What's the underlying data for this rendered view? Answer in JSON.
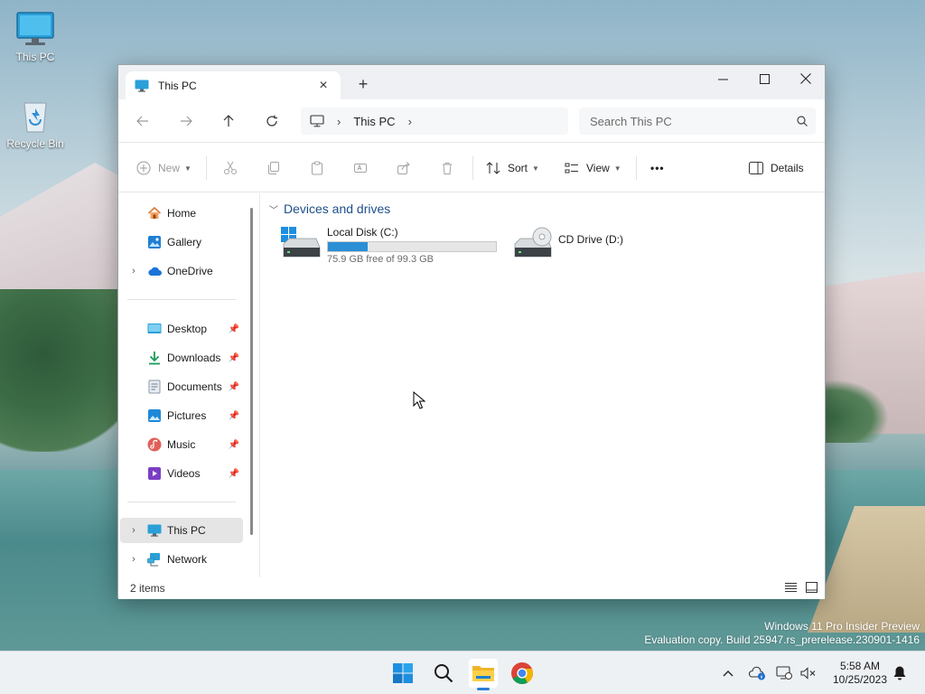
{
  "desktop": {
    "icons": [
      {
        "label": "This PC"
      },
      {
        "label": "Recycle Bin"
      }
    ],
    "watermark": {
      "line1": "Windows 11 Pro Insider Preview",
      "line2": "Evaluation copy. Build 25947.rs_prerelease.230901-1416"
    }
  },
  "window": {
    "tab": {
      "title": "This PC",
      "icon": "monitor-icon"
    },
    "new_tab_label": "+",
    "controls": {
      "minimize": "—",
      "maximize": "☐",
      "close": "✕"
    },
    "address": {
      "crumb_root_icon": "monitor-icon",
      "crumbs": [
        "This PC"
      ]
    },
    "search": {
      "placeholder": "Search This PC",
      "value": ""
    },
    "toolbar": {
      "new_label": "New",
      "sort_label": "Sort",
      "view_label": "View",
      "more_label": "•••",
      "details_label": "Details"
    },
    "nav": {
      "items": [
        {
          "label": "Home",
          "icon": "home-icon"
        },
        {
          "label": "Gallery",
          "icon": "gallery-icon"
        },
        {
          "label": "OneDrive",
          "icon": "cloud-icon"
        },
        {
          "label": "Desktop",
          "icon": "desktop-folder-icon"
        },
        {
          "label": "Downloads",
          "icon": "download-icon"
        },
        {
          "label": "Documents",
          "icon": "document-icon"
        },
        {
          "label": "Pictures",
          "icon": "pictures-icon"
        },
        {
          "label": "Music",
          "icon": "music-icon"
        },
        {
          "label": "Videos",
          "icon": "video-icon"
        },
        {
          "label": "This PC",
          "icon": "monitor-icon"
        },
        {
          "label": "Network",
          "icon": "network-icon"
        }
      ],
      "selected": "This PC"
    },
    "content": {
      "group_title": "Devices and drives",
      "drives": [
        {
          "name": "Local Disk (C:)",
          "free_text": "75.9 GB free of 99.3 GB",
          "used_fraction": 0.236,
          "icon": "windows-drive-icon"
        },
        {
          "name": "CD Drive (D:)",
          "icon": "cd-drive-icon"
        }
      ]
    },
    "status": {
      "item_count": "2 items"
    }
  },
  "taskbar": {
    "apps": [
      "start-icon",
      "search-icon",
      "file-explorer-icon",
      "chrome-icon"
    ],
    "active_app": "file-explorer-icon",
    "clock": {
      "time": "5:58 AM",
      "date": "10/25/2023"
    }
  },
  "colors": {
    "accent": "#2b8fd6",
    "group_title": "#1d4f8a",
    "drive_bar_fill": "#2b8fd6"
  }
}
